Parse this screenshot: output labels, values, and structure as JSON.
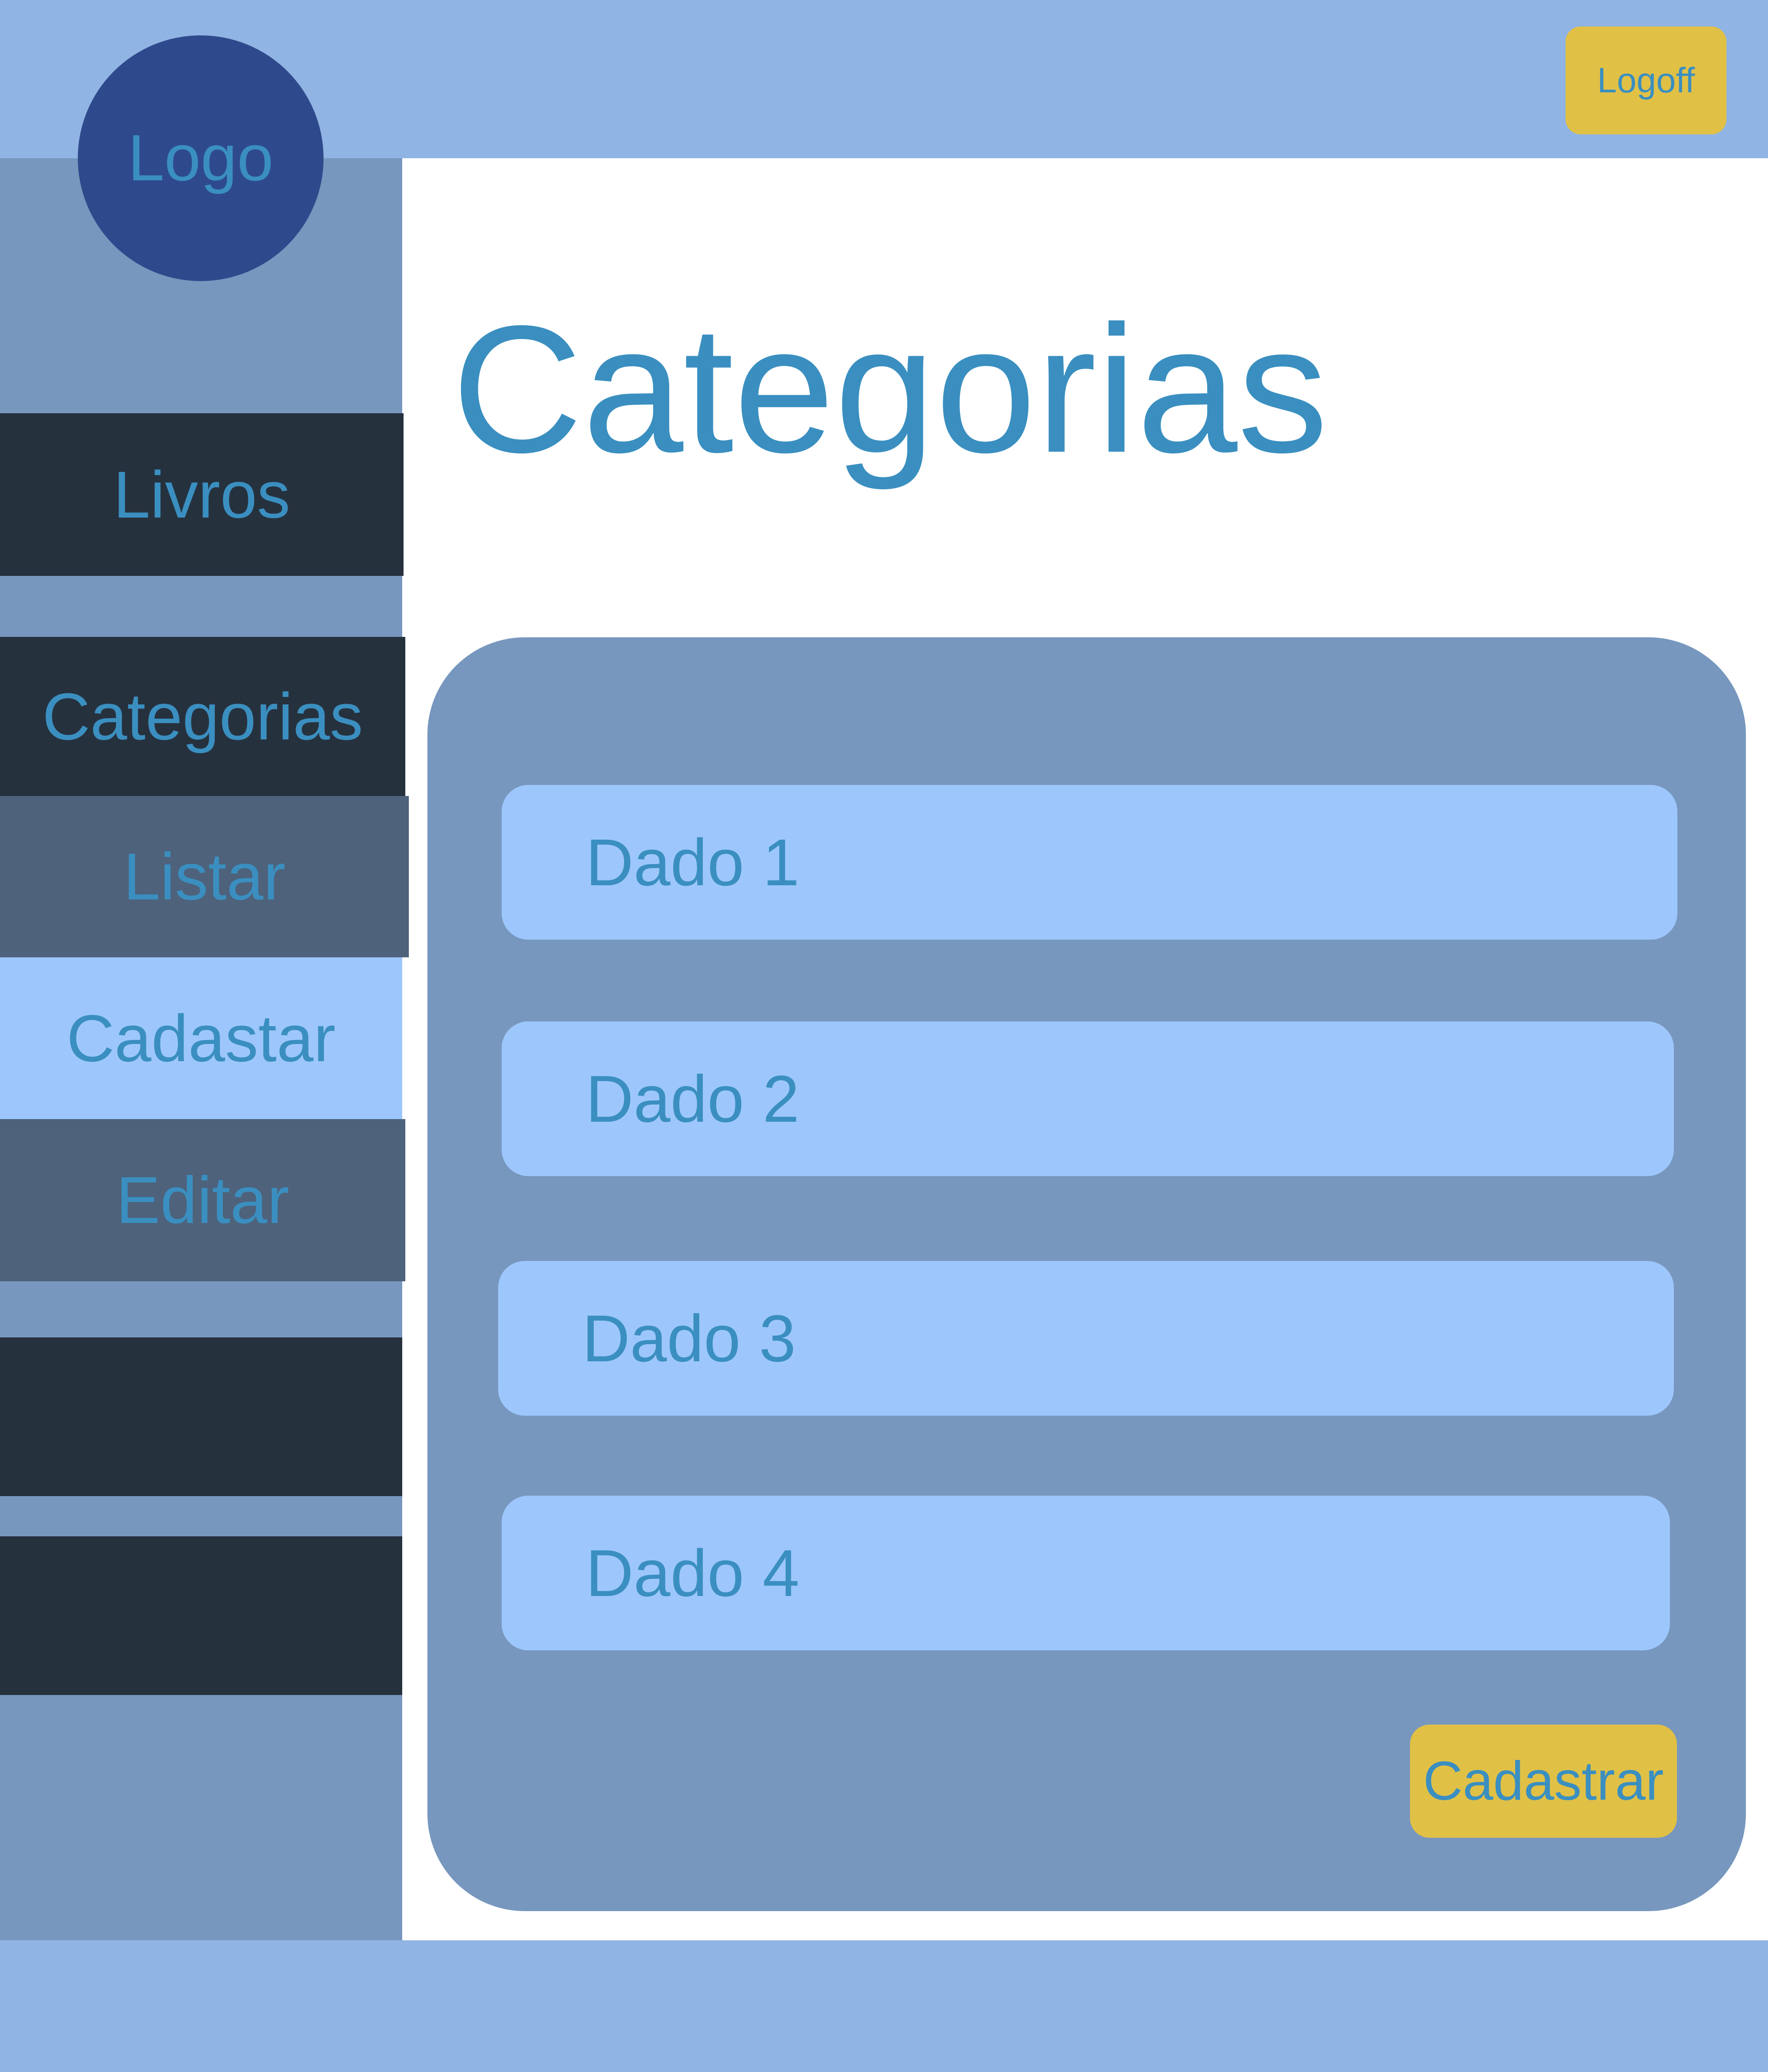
{
  "header": {
    "logo_label": "Logo",
    "logoff_label": "Logoff"
  },
  "sidebar": {
    "items": [
      {
        "label": "Livros"
      },
      {
        "label": "Categorias"
      },
      {
        "label": "Listar"
      },
      {
        "label": "Cadastar"
      },
      {
        "label": "Editar"
      },
      {
        "label": ""
      },
      {
        "label": ""
      }
    ]
  },
  "main": {
    "title": "Categorias",
    "rows": [
      {
        "label": "Dado 1"
      },
      {
        "label": "Dado 2"
      },
      {
        "label": "Dado 3"
      },
      {
        "label": "Dado 4"
      }
    ],
    "submit_label": "Cadastrar"
  },
  "colors": {
    "header_bg": "#90b4e3",
    "sidebar_bg": "#7797be",
    "dark_item": "#26313e",
    "mid_item": "#4e627c",
    "active_item": "#9dc7fc",
    "logo_bg": "#2f4a8c",
    "accent_button": "#e1c046",
    "text": "#3a8fc0"
  }
}
